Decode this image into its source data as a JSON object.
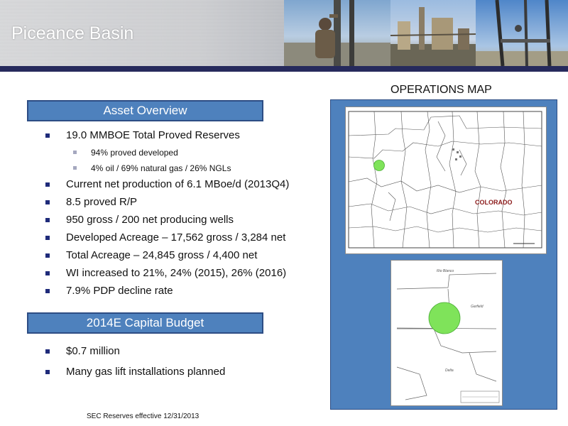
{
  "header": {
    "title": "Piceance Basin"
  },
  "asset_overview": {
    "heading": "Asset Overview",
    "bullets": {
      "reserves": "19.0 MMBOE Total Proved Reserves",
      "proved_developed": "94% proved developed",
      "mix": "4% oil / 69% natural gas / 26% NGLs",
      "production": "Current net production of 6.1 MBoe/d (2013Q4)",
      "rp": "8.5 proved R/P",
      "wells": "950 gross / 200 net producing wells",
      "developed_acreage": "Developed Acreage – 17,562 gross  / 3,284 net",
      "total_acreage": "Total Acreage – 24,845 gross  / 4,400 net",
      "wi": "WI increased to 21%, 24% (2015), 26% (2016)",
      "decline": "7.9% PDP decline rate"
    }
  },
  "capital_budget": {
    "heading": "2014E Capital Budget",
    "bullets": {
      "amount": "$0.7 million",
      "gas_lift": "Many gas lift installations planned"
    }
  },
  "footnote": "SEC Reserves effective 12/31/2013",
  "operations_map": {
    "title": "OPERATIONS MAP",
    "state_label": "COLORADO",
    "inset_labels": {
      "north": "Rio Blanco",
      "east": "Garfield",
      "south": "Delta"
    },
    "colors": {
      "panel": "#4e81bd",
      "marker": "#7fe35a",
      "state_label": "#8b1a1a"
    }
  }
}
